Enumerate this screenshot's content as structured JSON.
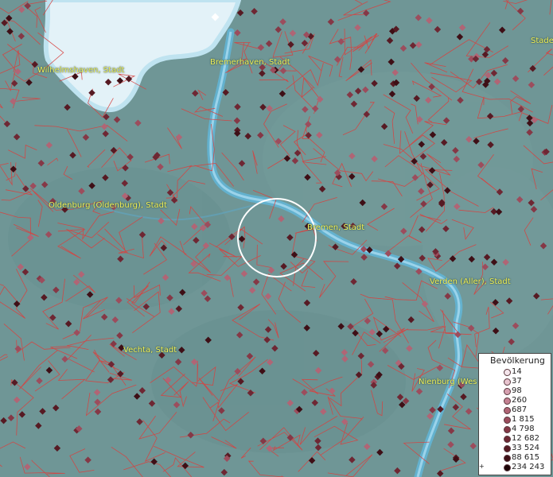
{
  "map": {
    "labels": [
      {
        "id": "wilhelmshaven",
        "text": "Wilhelmshaven, Stadt"
      },
      {
        "id": "bremerhaven",
        "text": "Bremerhaven, Stadt"
      },
      {
        "id": "stade",
        "text": "Stade"
      },
      {
        "id": "oldenburg",
        "text": "Oldenburg (Oldenburg), Stadt"
      },
      {
        "id": "bremen",
        "text": "Bremen, Stadt"
      },
      {
        "id": "verden",
        "text": "Verden (Aller), Stadt"
      },
      {
        "id": "vechta",
        "text": "Vechta, Stadt"
      },
      {
        "id": "nienburg",
        "text": "Nienburg (Wes"
      }
    ],
    "colors": {
      "land": "#6f9696",
      "water": "#dff0f7",
      "river": "#5fb3d6",
      "boundary": "#d8413f",
      "label": "#f2f25a",
      "highlight_circle": "#ffffff"
    }
  },
  "legend": {
    "title": "Bevölkerung",
    "items": [
      {
        "label": "14",
        "color": "#f5e6ec"
      },
      {
        "label": "37",
        "color": "#e8c4cf"
      },
      {
        "label": "98",
        "color": "#d6a0b0"
      },
      {
        "label": "260",
        "color": "#c48192"
      },
      {
        "label": "687",
        "color": "#b06575"
      },
      {
        "label": "1 815",
        "color": "#9c4d5d"
      },
      {
        "label": "4 798",
        "color": "#853846"
      },
      {
        "label": "12 682",
        "color": "#6e2733"
      },
      {
        "label": "33 524",
        "color": "#561a23"
      },
      {
        "label": "88 615",
        "color": "#3e0f16"
      },
      {
        "label": "234 243",
        "color": "#1e0508"
      }
    ],
    "plus": "+"
  }
}
